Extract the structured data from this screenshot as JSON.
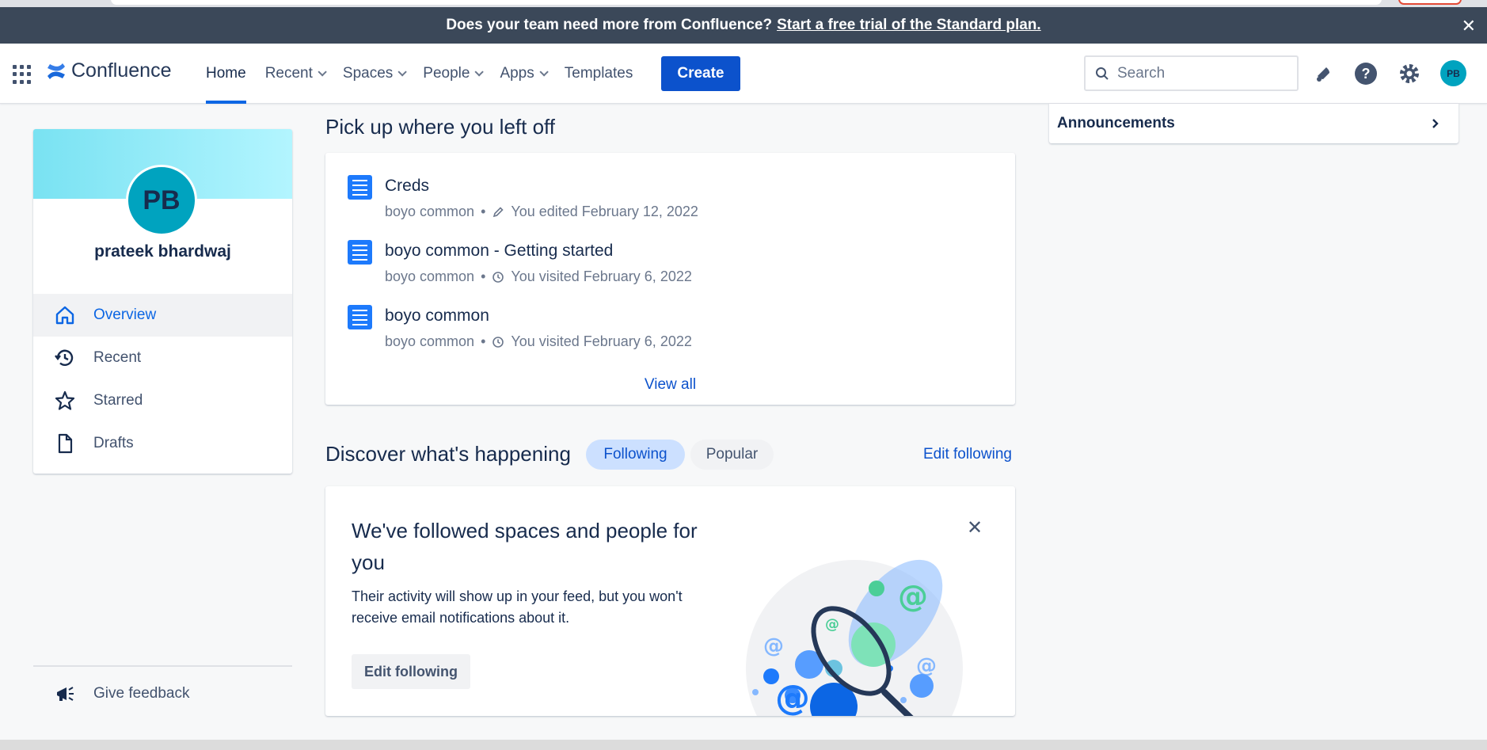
{
  "banner": {
    "text": "Does your team need more from Confluence?",
    "link": "Start a free trial of the Standard plan.",
    "close": "✕"
  },
  "nav": {
    "logo": "Confluence",
    "items": [
      {
        "label": "Home"
      },
      {
        "label": "Recent"
      },
      {
        "label": "Spaces"
      },
      {
        "label": "People"
      },
      {
        "label": "Apps"
      },
      {
        "label": "Templates"
      }
    ],
    "create": "Create",
    "search_placeholder": "Search",
    "avatar": "PB"
  },
  "profile": {
    "initials": "PB",
    "name": "prateek bhardwaj",
    "menu": [
      {
        "label": "Overview",
        "icon": "home-icon"
      },
      {
        "label": "Recent",
        "icon": "history-icon"
      },
      {
        "label": "Starred",
        "icon": "star-icon"
      },
      {
        "label": "Drafts",
        "icon": "draft-icon"
      }
    ],
    "feedback": "Give feedback"
  },
  "recent": {
    "title": "Pick up where you left off",
    "items": [
      {
        "title": "Creds",
        "space": "boyo common",
        "action": "You edited February 12, 2022",
        "icon": "pencil-icon"
      },
      {
        "title": "boyo common - Getting started",
        "space": "boyo common",
        "action": "You visited February 6, 2022",
        "icon": "clock-icon"
      },
      {
        "title": "boyo common",
        "space": "boyo common",
        "action": "You visited February 6, 2022",
        "icon": "clock-icon"
      }
    ],
    "view_all": "View all"
  },
  "discover": {
    "title": "Discover what's happening",
    "following": "Following",
    "popular": "Popular",
    "edit": "Edit following"
  },
  "follow_card": {
    "title": "We've followed spaces and people for you",
    "desc": "Their activity will show up in your feed, but you won't receive email notifications about it.",
    "button": "Edit following",
    "close": "✕"
  },
  "right": {
    "announcements": "Announcements"
  },
  "colors": {
    "primary": "#0c52cc",
    "banner": "#3b4859",
    "avatar": "#00a3bf"
  }
}
